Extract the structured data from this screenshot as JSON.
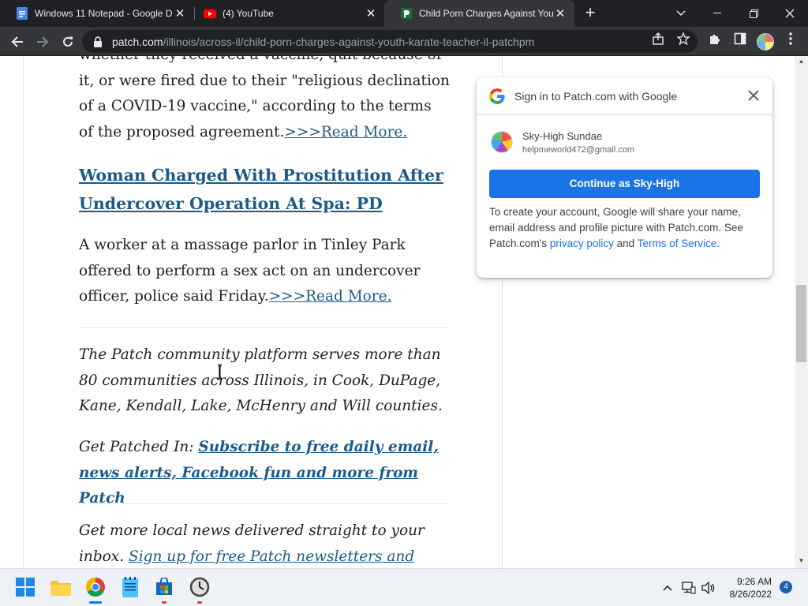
{
  "browser": {
    "tabs": [
      {
        "title": "Windows 11 Notepad - Google D",
        "favicon": "google-docs-icon"
      },
      {
        "title": "(4) YouTube",
        "favicon": "youtube-icon"
      },
      {
        "title": "Child Porn Charges Against Youth",
        "favicon": "patch-icon",
        "active": true
      }
    ],
    "new_tab_label": "+",
    "url_host": "patch.com",
    "url_path": "/illinois/across-il/child-porn-charges-against-youth-karate-teacher-il-patchpm"
  },
  "article": {
    "para1_text": "whether they received a vaccine, quit because of it, or were fired due to their \"religious declination of a COVID-19 vaccine,\" according to the terms of the proposed agreement.",
    "para1_link": ">>>Read More.",
    "headline": "Woman Charged With Prostitution After Undercover Operation At Spa: PD",
    "para2_text": "A worker at a massage parlor in Tinley Park offered to perform a sex act on an undercover officer, police said Friday.",
    "para2_link": ">>>Read More.",
    "community_text": "The Patch community platform serves more than 80 communities across Illinois, in Cook, DuPage, Kane, Kendall, Lake, McHenry and Will counties.",
    "patched_in_prefix": "Get Patched In: ",
    "patched_in_link": "Subscribe to free daily email, news alerts, Facebook fun and more from Patch",
    "local_news_prefix": "Get more local news delivered straight to your inbox. ",
    "local_news_link": "Sign up for free Patch newsletters and alerts."
  },
  "google_signin": {
    "title": "Sign in to Patch.com with Google",
    "account_name": "Sky-High Sundae",
    "account_email": "helpmeworld472@gmail.com",
    "continue_label": "Continue as Sky-High",
    "disclaimer_prefix": "To create your account, Google will share your name, email address and profile picture with Patch.com. See Patch.com's ",
    "privacy_link": "privacy policy",
    "and_text": " and ",
    "terms_link": "Terms of Service",
    "end_text": "."
  },
  "taskbar": {
    "time": "9:26 AM",
    "date": "8/26/2022",
    "notification_count": "4"
  },
  "colors": {
    "accent": "#1a73e8",
    "article_link": "#1b5a8a",
    "tab_bg": "#202124",
    "toolbar_bg": "#35363a"
  }
}
